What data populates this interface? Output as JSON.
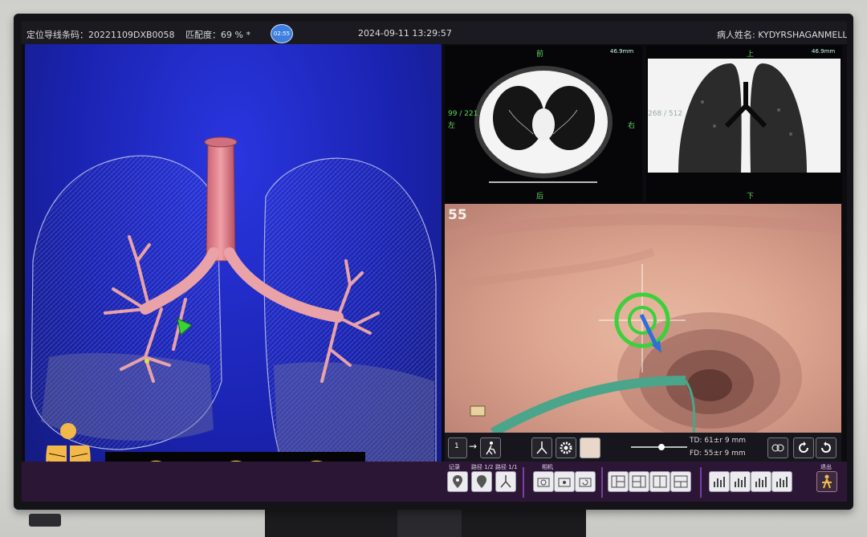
{
  "status_bar": {
    "catheter_code": "定位导线条码：20221109DXB0058",
    "match": "匹配度：69 % *",
    "timer": "02:55",
    "datetime": "2024-09-11 13:29:57",
    "patient": "病人姓名: KYDYRSHAGANMELLAT"
  },
  "ct_axial": {
    "orient_top": "前",
    "orient_left": "左",
    "orient_right": "右",
    "orient_bottom": "后",
    "slice": "99 / 221",
    "scale": "46.9mm"
  },
  "ct_coronal": {
    "orient_top": "上",
    "orient_bottom": "下",
    "slice": "268 / 512",
    "scale": "46.9mm"
  },
  "endo_view": {
    "label": "55"
  },
  "controls": {
    "td": "TD:    61±r 9 mm",
    "fd": "FD:    55±r 9 mm",
    "step": "1"
  },
  "buttons": {
    "record": "记录",
    "goto1": "路径 1/2",
    "goto2": "路径 1/1",
    "camera": "相机",
    "exit": "退出"
  },
  "colors": {
    "accent": "#7a3fa0",
    "bar": "#2c1636",
    "target": "#3ad13a",
    "pointer": "#2f6fd6"
  }
}
